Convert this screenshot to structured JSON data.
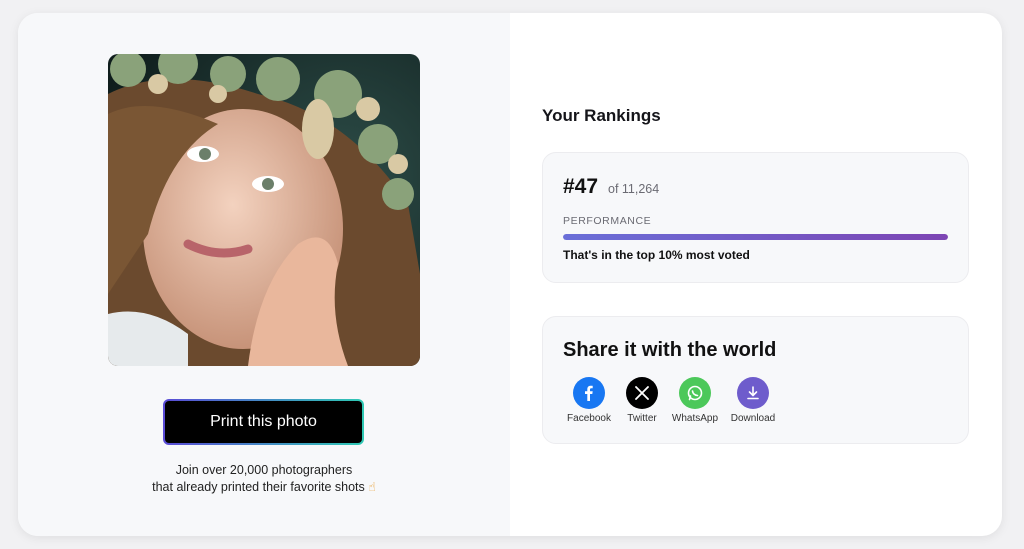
{
  "left": {
    "print_button": "Print this photo",
    "join_line1": "Join over 20,000 photographers",
    "join_line2": "that already printed their favorite shots",
    "join_emoji": "☝"
  },
  "rankings": {
    "title": "Your Rankings",
    "rank": "#47",
    "of_total": "of 11,264",
    "performance_label": "PERFORMANCE",
    "performance_fraction": 1.0,
    "note": "That's in the top 10% most voted"
  },
  "share": {
    "title": "Share it with the world",
    "items": [
      {
        "label": "Facebook",
        "icon": "facebook-icon",
        "color": "#1877f2"
      },
      {
        "label": "Twitter",
        "icon": "x-icon",
        "color": "#000000"
      },
      {
        "label": "WhatsApp",
        "icon": "whatsapp-icon",
        "color": "#4cc85a"
      },
      {
        "label": "Download",
        "icon": "download-icon",
        "color": "#6e5ccc"
      }
    ]
  }
}
